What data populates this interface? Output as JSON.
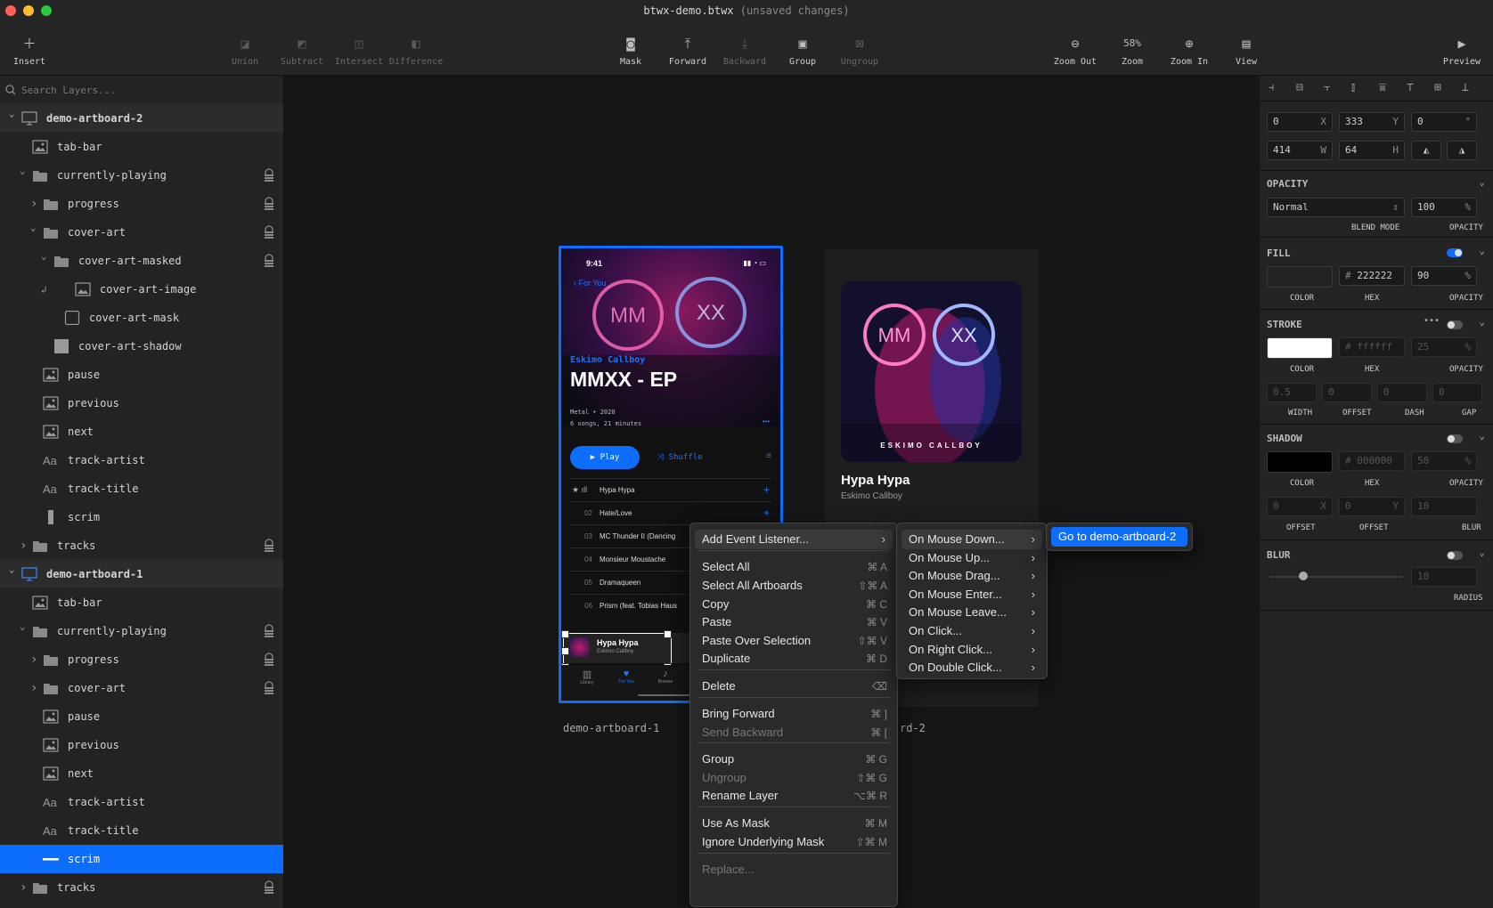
{
  "window": {
    "title": "btwx-demo.btwx",
    "title_suffix": "(unsaved changes)"
  },
  "toolbar": {
    "insert": "Insert",
    "union": "Union",
    "subtract": "Subtract",
    "intersect": "Intersect",
    "difference": "Difference",
    "mask": "Mask",
    "forward": "Forward",
    "backward": "Backward",
    "group": "Group",
    "ungroup": "Ungroup",
    "zoom_out": "Zoom Out",
    "zoom_value": "58%",
    "zoom": "Zoom",
    "zoom_in": "Zoom In",
    "view": "View",
    "preview": "Preview"
  },
  "search": {
    "placeholder": "Search Layers..."
  },
  "layers": [
    "demo-artboard-2",
    "tab-bar",
    "currently-playing",
    "progress",
    "cover-art",
    "cover-art-masked",
    "cover-art-image",
    "cover-art-mask",
    "cover-art-shadow",
    "pause",
    "previous",
    "next",
    "track-artist",
    "track-title",
    "scrim",
    "tracks",
    "demo-artboard-1",
    "tab-bar",
    "currently-playing",
    "progress",
    "cover-art",
    "pause",
    "previous",
    "next",
    "track-artist",
    "track-title",
    "scrim",
    "tracks"
  ],
  "inspector": {
    "x": "0",
    "x_suffix": "X",
    "y": "333",
    "y_suffix": "Y",
    "rotation": "0",
    "rotation_suffix": "°",
    "w": "414",
    "w_suffix": "W",
    "h": "64",
    "h_suffix": "H",
    "opacity": {
      "header": "OPACITY",
      "blend": "Normal",
      "value": "100",
      "pct": "%",
      "blend_label": "BLEND MODE",
      "opacity_label": "OPACITY"
    },
    "fill": {
      "header": "FILL",
      "hex": "222222",
      "hash": "#",
      "opacity": "90",
      "pct": "%",
      "color_label": "COLOR",
      "hex_label": "HEX",
      "opacity_label": "OPACITY",
      "enabled": true
    },
    "stroke": {
      "header": "STROKE",
      "hex": "ffffff",
      "hash": "#",
      "opacity": "25",
      "pct": "%",
      "color_label": "COLOR",
      "hex_label": "HEX",
      "opacity_label": "OPACITY",
      "width": "0.5",
      "offset": "0",
      "dash": "0",
      "gap": "0",
      "width_label": "WIDTH",
      "offset_label": "OFFSET",
      "dash_label": "DASH",
      "gap_label": "GAP",
      "enabled": false
    },
    "shadow": {
      "header": "SHADOW",
      "hex": "000000",
      "hash": "#",
      "opacity": "50",
      "pct": "%",
      "color_label": "COLOR",
      "hex_label": "HEX",
      "opacity_label": "OPACITY",
      "x": "0",
      "x_suffix": "X",
      "y": "0",
      "y_suffix": "Y",
      "blur": "10",
      "offset_label": "OFFSET",
      "blur_label": "BLUR",
      "enabled": false
    },
    "blur": {
      "header": "BLUR",
      "radius": "10",
      "radius_label": "RADIUS",
      "enabled": false
    }
  },
  "artboard1": {
    "label": "demo-artboard-1",
    "status_time": "9:41",
    "back": "For You",
    "artist": "Eskimo Callboy",
    "album": "MMXX - EP",
    "genre": "Metal • 2020",
    "meta": "6 songs, 21 minutes",
    "more": "•••",
    "play": "Play",
    "shuffle": "Shuffle",
    "tracks": [
      {
        "num": "",
        "title": "Hypa Hypa",
        "action": "+"
      },
      {
        "num": "02",
        "title": "Hate/Love",
        "action": "+"
      },
      {
        "num": "03",
        "title": "MC Thunder II (Dancing"
      },
      {
        "num": "04",
        "title": "Monsieur Moustache"
      },
      {
        "num": "05",
        "title": "Dramaqueen"
      },
      {
        "num": "06",
        "title": "Prism (feat. Tobias Haus"
      }
    ],
    "np_title": "Hypa Hypa",
    "np_artist": "Eskimo Callboy",
    "tabs": [
      "Library",
      "For You",
      "Browse"
    ]
  },
  "artboard2": {
    "label_fragment": "rd-2",
    "cover_text": "ESKIMO CALLBOY",
    "title": "Hypa Hypa",
    "artist": "Eskimo Callboy"
  },
  "context_menu": {
    "items": [
      {
        "label": "Add Event Listener...",
        "shortcut": "",
        "submenu": true
      },
      {
        "label": "Select All",
        "shortcut": "⌘ A"
      },
      {
        "label": "Select All Artboards",
        "shortcut": "⇧⌘ A"
      },
      {
        "label": "Copy",
        "shortcut": "⌘ C"
      },
      {
        "label": "Paste",
        "shortcut": "⌘ V"
      },
      {
        "label": "Paste Over Selection",
        "shortcut": "⇧⌘ V"
      },
      {
        "label": "Duplicate",
        "shortcut": "⌘ D"
      },
      {
        "label": "Delete",
        "shortcut": "⌫"
      },
      {
        "label": "Bring Forward",
        "shortcut": "⌘ ]"
      },
      {
        "label": "Send Backward",
        "shortcut": "⌘ ["
      },
      {
        "label": "Group",
        "shortcut": "⌘ G"
      },
      {
        "label": "Ungroup",
        "shortcut": "⇧⌘ G"
      },
      {
        "label": "Rename Layer",
        "shortcut": "⌥⌘ R"
      },
      {
        "label": "Use As Mask",
        "shortcut": "⌘ M"
      },
      {
        "label": "Ignore Underlying Mask",
        "shortcut": "⇧⌘ M"
      },
      {
        "label": "Replace...",
        "shortcut": ""
      }
    ],
    "events": [
      "On Mouse Down...",
      "On Mouse Up...",
      "On Mouse Drag...",
      "On Mouse Enter...",
      "On Mouse Leave...",
      "On Click...",
      "On Right Click...",
      "On Double Click..."
    ],
    "action": "Go to demo-artboard-2"
  },
  "colors": {
    "accent": "#0d6efd",
    "panel": "#232323",
    "canvas": "#161616"
  }
}
